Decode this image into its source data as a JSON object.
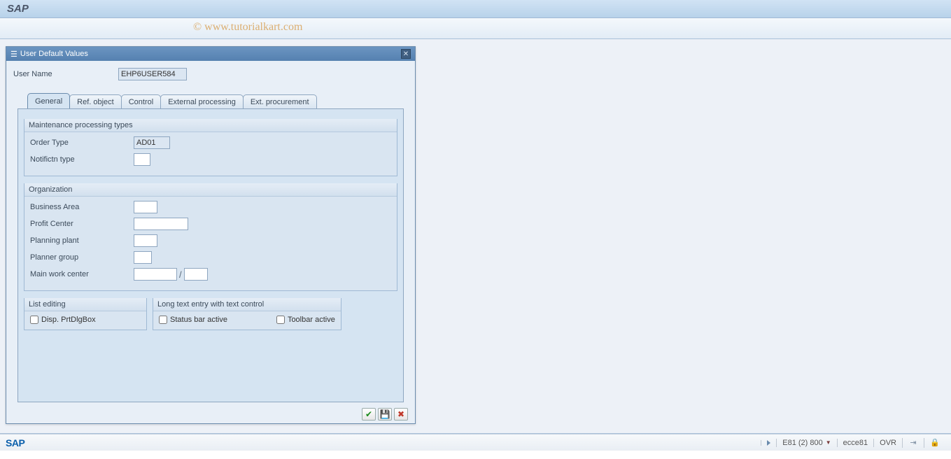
{
  "app": {
    "title": "SAP"
  },
  "watermark": "© www.tutorialkart.com",
  "dialog": {
    "title": "User Default Values",
    "user_name_label": "User Name",
    "user_name_value": "EHP6USER584"
  },
  "tabs": {
    "general": "General",
    "ref_object": "Ref. object",
    "control": "Control",
    "ext_processing": "External processing",
    "ext_procurement": "Ext. procurement"
  },
  "groups": {
    "maint_types": {
      "title": "Maintenance processing types",
      "order_type_label": "Order Type",
      "order_type_value": "AD01",
      "notif_type_label": "Notifictn type",
      "notif_type_value": ""
    },
    "org": {
      "title": "Organization",
      "business_area_label": "Business Area",
      "business_area_value": "",
      "profit_center_label": "Profit Center",
      "profit_center_value": "",
      "planning_plant_label": "Planning plant",
      "planning_plant_value": "",
      "planner_group_label": "Planner group",
      "planner_group_value": "",
      "main_wc_label": "Main work center",
      "main_wc_value1": "",
      "main_wc_value2": ""
    },
    "list_editing": {
      "title": "List editing",
      "disp_prt_label": "Disp. PrtDlgBox"
    },
    "long_text": {
      "title": "Long text entry with text control",
      "status_bar_label": "Status bar active",
      "toolbar_label": "Toolbar active"
    }
  },
  "actions": {
    "ok_glyph": "✔",
    "save_glyph": "💾",
    "cancel_glyph": "✖"
  },
  "status": {
    "sap": "SAP",
    "system": "E81 (2) 800",
    "host": "ecce81",
    "mode": "OVR"
  }
}
